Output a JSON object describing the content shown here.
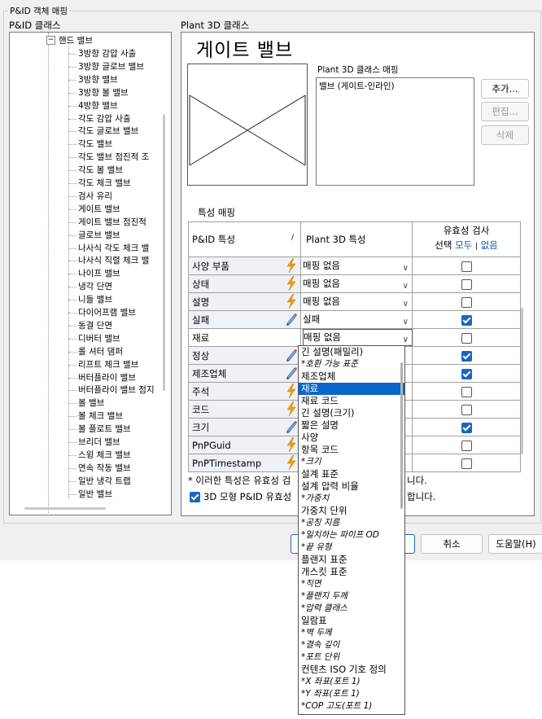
{
  "window": {
    "group_title": "P&ID 객체 매핑"
  },
  "left": {
    "title": "P&ID 클래스",
    "parent": "핸드 밸브",
    "items": [
      "3방향 감압 사출",
      "3방향 글로브 밸브",
      "3방향 밸브",
      "3방향 볼 밸브",
      "4방향 밸브",
      "각도 감압 사출",
      "각도 글로브 밸브",
      "각도 밸브",
      "각도 밸브 점진적 조",
      "각도 볼 밸브",
      "각도 체크 밸브",
      "검사 유리",
      "게이트 밸브",
      "게이트 밸브 점진적",
      "글로브 밸브",
      "나사식 각도 체크 밸",
      "나사식 직렬 체크 밸",
      "나이프 밸브",
      "냉각 단면",
      "니들 밸브",
      "다이어프램 밸브",
      "동결 단면",
      "디버터 밸브",
      "롤 셔터 댐퍼",
      "리프트 체크 밸브",
      "버터플라이 밸브",
      "버터플라이 밸브 점지",
      "볼 밸브",
      "볼 체크 밸브",
      "볼 플로트 밸브",
      "브리더 밸브",
      "스윙 체크 밸브",
      "연속 작동 밸브",
      "일반 냉각 트랩",
      "일반 밸브"
    ]
  },
  "right": {
    "title": "Plant 3D 클래스",
    "class_name": "게이트 밸브",
    "mapping_label": "Plant 3D 클래스 매핑",
    "mapping_items": [
      "밸브 (게이트-인라인)"
    ],
    "buttons": {
      "add": "추가...",
      "edit": "편집...",
      "delete": "삭제"
    },
    "prop_mapping_label": "특성 매핑"
  },
  "grid": {
    "col_pid": "P&ID 특성",
    "col_p3d": "Plant 3D 특성",
    "col_val_title": "유효성 검사",
    "col_val_select": "선택",
    "col_val_all": "모두",
    "col_val_sep": "|",
    "col_val_none": "없음",
    "rows": [
      {
        "name": "사양 부품",
        "icon": "bolt",
        "p3d": "매핑 없음",
        "checked": false,
        "dropdown": true
      },
      {
        "name": "상태",
        "icon": "bolt",
        "p3d": "매핑 없음",
        "checked": false,
        "dropdown": true
      },
      {
        "name": "설명",
        "icon": "bolt",
        "p3d": "매핑 없음",
        "checked": false,
        "dropdown": true
      },
      {
        "name": "실패",
        "icon": "pencil",
        "p3d": "실패",
        "checked": true,
        "dropdown": true
      },
      {
        "name": "재료",
        "icon": "",
        "p3d": "매핑 없음",
        "checked": false,
        "dropdown": true
      },
      {
        "name": "정상",
        "icon": "pencil",
        "p3d": "",
        "checked": true,
        "dropdown": false
      },
      {
        "name": "제조업체",
        "icon": "pencil",
        "p3d": "",
        "checked": true,
        "dropdown": false
      },
      {
        "name": "주석",
        "icon": "bolt",
        "p3d": "",
        "checked": false,
        "dropdown": false
      },
      {
        "name": "코드",
        "icon": "bolt",
        "p3d": "",
        "checked": false,
        "dropdown": false
      },
      {
        "name": "크기",
        "icon": "pencil",
        "p3d": "",
        "checked": true,
        "dropdown": false
      },
      {
        "name": "PnPGuid",
        "icon": "bolt",
        "p3d": "",
        "checked": false,
        "dropdown": false
      },
      {
        "name": "PnPTimestamp",
        "icon": "bolt",
        "p3d": "",
        "checked": false,
        "dropdown": false
      }
    ]
  },
  "footnote": {
    "text": "* 이러한 특성은 유효성 검",
    "tail": "니다."
  },
  "check3d": {
    "text": "3D 모형 P&ID 유효성",
    "tail": "합니다.",
    "checked": true
  },
  "bottom_buttons": {
    "cancel": "취소",
    "help": "도움말(H)"
  },
  "dropdown": {
    "items": [
      {
        "t": "긴 설명(패밀리)",
        "i": false
      },
      {
        "t": "*호환 가능 표준",
        "i": true
      },
      {
        "t": "제조업체",
        "i": false
      },
      {
        "t": "재료",
        "i": false,
        "sel": true
      },
      {
        "t": "재료 코드",
        "i": false
      },
      {
        "t": "긴 설명(크기)",
        "i": false
      },
      {
        "t": "짧은 설명",
        "i": false
      },
      {
        "t": "사양",
        "i": false
      },
      {
        "t": "항목 코드",
        "i": false
      },
      {
        "t": "*크기",
        "i": true
      },
      {
        "t": "설계 표준",
        "i": false
      },
      {
        "t": "설계 압력 비율",
        "i": false
      },
      {
        "t": "*가중치",
        "i": true
      },
      {
        "t": "가중치 단위",
        "i": false
      },
      {
        "t": "*공칭 지름",
        "i": true
      },
      {
        "t": "*일치하는 파이프 OD",
        "i": true
      },
      {
        "t": "*끝 유형",
        "i": true
      },
      {
        "t": "플랜지 표준",
        "i": false
      },
      {
        "t": "개스킷 표준",
        "i": false
      },
      {
        "t": "*직면",
        "i": true
      },
      {
        "t": "*플랜지 두께",
        "i": true
      },
      {
        "t": "*압력 클래스",
        "i": true
      },
      {
        "t": "일람표",
        "i": false
      },
      {
        "t": "*벽 두께",
        "i": true
      },
      {
        "t": "*결속 깊이",
        "i": true
      },
      {
        "t": "*포트 단위",
        "i": true
      },
      {
        "t": "컨텐츠 ISO 기호 정의",
        "i": false
      },
      {
        "t": "*X 좌표(포트 1)",
        "i": true
      },
      {
        "t": "*Y 좌표(포트 1)",
        "i": true
      },
      {
        "t": "*COP 고도(포트 1)",
        "i": true
      }
    ]
  }
}
